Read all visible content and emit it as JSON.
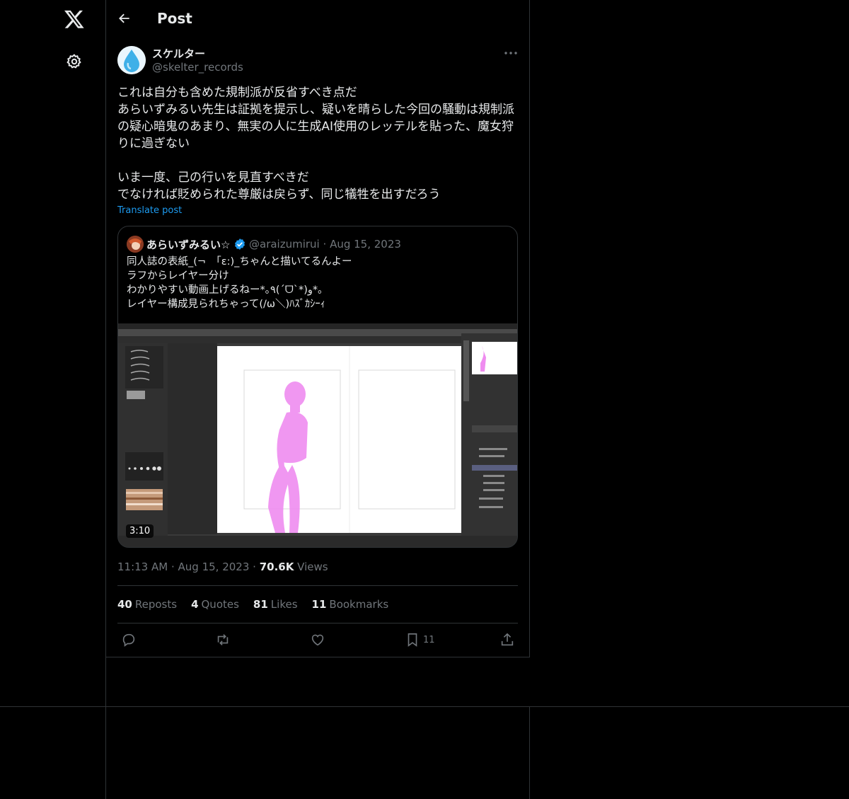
{
  "header": {
    "title": "Post"
  },
  "author": {
    "name": "スケルター",
    "handle": "@skelter_records"
  },
  "post": {
    "text": "これは自分も含めた規制派が反省すべき点だ\nあらいずみるい先生は証拠を提示し、疑いを晴らした今回の騒動は規制派の疑心暗鬼のあまり、無実の人に生成AI使用のレッテルを貼った、魔女狩りに過ぎない\n\nいま一度、己の行いを見直すべきだ\nでなければ貶められた尊厳は戻らず、同じ犠牲を出すだろう",
    "translate_label": "Translate post"
  },
  "quote": {
    "name": "あらいずみるい☆",
    "handle": "@araizumirui",
    "date": "Aug 15, 2023",
    "text": "同人誌の表紙_(¬　「ε:)_ちゃんと描いてるんよー\nラフからレイヤー分け\nわかりやすい動画上げるねー*｡٩(ˊᗜˋ*)و*｡\nレイヤー構成見られちゃって(/ω＼)ﾊｽﾞｶｼｰｨ",
    "video_duration": "3:10"
  },
  "meta": {
    "time": "11:13 AM",
    "date": "Aug 15, 2023",
    "views_count": "70.6K",
    "views_label": "Views"
  },
  "stats": [
    {
      "count": "40",
      "label": "Reposts"
    },
    {
      "count": "4",
      "label": "Quotes"
    },
    {
      "count": "81",
      "label": "Likes"
    },
    {
      "count": "11",
      "label": "Bookmarks"
    }
  ],
  "actions": {
    "bookmark_count": "11"
  },
  "icons": [
    "x-logo-icon",
    "gear-icon",
    "back-arrow-icon",
    "more-icon",
    "verified-icon",
    "reply-icon",
    "repost-icon",
    "like-icon",
    "bookmark-icon",
    "share-icon"
  ],
  "colors": {
    "background": "#000000",
    "text": "#e7e9ea",
    "muted": "#71767b",
    "accent": "#1d9bf0",
    "border": "#2f3336"
  }
}
